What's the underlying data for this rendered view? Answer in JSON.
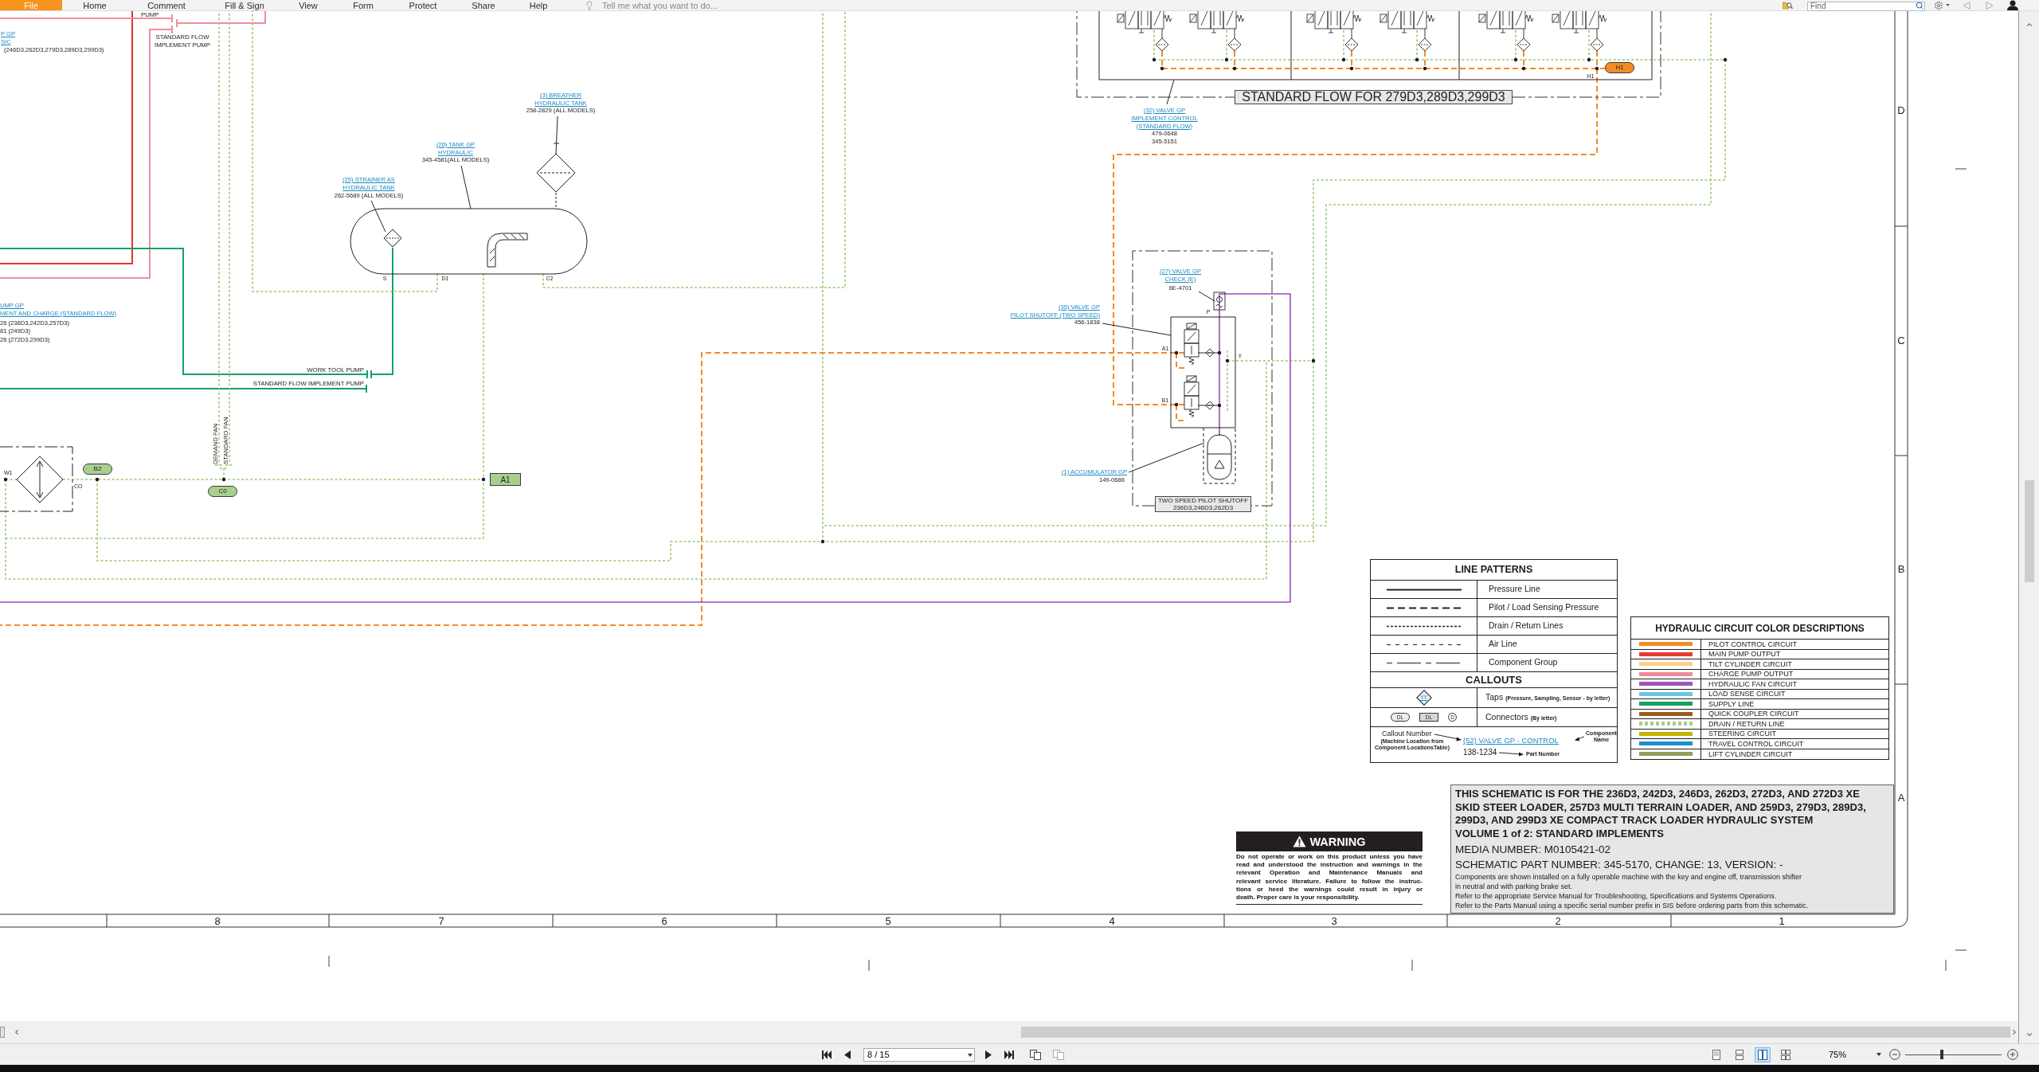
{
  "menu_bar": {
    "items": [
      {
        "label": "File",
        "kind": "file"
      },
      {
        "label": "Home",
        "kind": "tab"
      },
      {
        "label": "Comment",
        "kind": "tab"
      },
      {
        "label": "Fill & Sign",
        "kind": "tab"
      },
      {
        "label": "View",
        "kind": "tab"
      },
      {
        "label": "Form",
        "kind": "tab"
      },
      {
        "label": "Protect",
        "kind": "tab"
      },
      {
        "label": "Share",
        "kind": "tab"
      },
      {
        "label": "Help",
        "kind": "tab"
      }
    ],
    "tell_me": {
      "placeholder": "Tell me what you want to do..."
    },
    "find": {
      "placeholder": "Find"
    }
  },
  "schematic": {
    "line_labels": [
      {
        "lines": [
          "PUMP"
        ]
      },
      {
        "lines": [
          "STANDARD FLOW",
          "IMPLEMENT PUMP"
        ]
      },
      {
        "lines": [
          "WORK TOOL PUMP"
        ]
      },
      {
        "lines": [
          "STANDARD FLOW IMPLEMENT PUMP"
        ]
      },
      {
        "lines": [
          "DEMAND FAN"
        ]
      },
      {
        "lines": [
          "STANDARD FAN"
        ]
      }
    ],
    "callouts": [
      {
        "name": [
          "P GP",
          "SIC"
        ],
        "parts": [
          "(246D3,262D3,279D3,289D3,299D3)"
        ]
      },
      {
        "name": [
          "UMP GP",
          "MENT AND CHARGE (STANDARD FLOW)"
        ],
        "parts": [
          "26 (236D3,242D3,257D3)",
          "81 (249D3)",
          "26 (272D3,299D3)"
        ]
      },
      {
        "name": [
          "(25) STRAINER AS",
          "HYDRAULIC TANK"
        ],
        "parts": [
          "262-5689 (ALL MODELS)"
        ]
      },
      {
        "name": [
          "(26) TANK GP",
          "HYDRAULIC"
        ],
        "parts": [
          "345-4581(ALL MODELS)"
        ]
      },
      {
        "name": [
          "(3) BREATHER",
          "HYDRAULIC TANK"
        ],
        "parts": [
          "258-2829 (ALL MODELS)"
        ]
      },
      {
        "name": [
          "(32) VALVE GP",
          "IMPLEMENT CONTROL",
          "(STANDARD FLOW)"
        ],
        "parts": [
          "479-0648",
          "345-5151"
        ]
      },
      {
        "name": [
          "(27) VALVE GP",
          "CHECK (E)"
        ],
        "parts": [
          "6E-4701"
        ]
      },
      {
        "name": [
          "(35) VALVE GP",
          "PILOT SHUTOFF (TWO SPEED)"
        ],
        "parts": [
          "456-1838"
        ]
      },
      {
        "name": [
          "(1) ACCUMULATOR GP"
        ],
        "parts": [
          "149-0686"
        ]
      }
    ],
    "port_labels": [
      "S",
      "D1",
      "C2",
      "W1",
      "CO",
      "H1",
      "P",
      "A1",
      "B1",
      "T"
    ],
    "connectors": [
      {
        "label": "B2",
        "kind": "pill",
        "color": "#a9cf8f"
      },
      {
        "label": "C0",
        "kind": "pill",
        "color": "#a9cf8f"
      },
      {
        "label": "A1",
        "kind": "tag",
        "color": "#a9cf8f"
      },
      {
        "label": "H1",
        "kind": "pill",
        "color": "#f28c28"
      }
    ],
    "group_labels": [
      {
        "lines": [
          "STANDARD FLOW FOR 279D3,289D3,299D3"
        ]
      },
      {
        "lines": [
          "TWO SPEED PILOT SHUTOFF",
          "236D3,246D3,262D3"
        ]
      }
    ]
  },
  "frame": {
    "rows": [
      "D",
      "C",
      "B",
      "A"
    ],
    "columns": [
      "8",
      "7",
      "6",
      "5",
      "4",
      "3",
      "2",
      "1"
    ]
  },
  "line_patterns": {
    "title": "LINE PATTERNS",
    "rows": [
      {
        "kind": "solid",
        "label": "Pressure Line"
      },
      {
        "kind": "long_dash",
        "label": "Pilot / Load Sensing Pressure"
      },
      {
        "kind": "short_dash",
        "label": "Drain / Return Lines"
      },
      {
        "kind": "sparse_dash",
        "label": "Air Line"
      },
      {
        "kind": "dash_dot",
        "label": "Component Group"
      }
    ],
    "callouts_title": "CALLOUTS",
    "taps": {
      "symbol": "YY",
      "label": "Taps",
      "note": "(Pressure, Sampling, Sensor - by letter)"
    },
    "connectors": {
      "symbols": [
        {
          "kind": "pill",
          "label": "DL"
        },
        {
          "kind": "tag",
          "label": "DL"
        },
        {
          "kind": "circle",
          "label": "D"
        }
      ],
      "label": "Connectors",
      "note": "(By letter)"
    },
    "example": {
      "callout_number": "Callout Number",
      "callout_note": "(Machine Location from Component LocationsTable)",
      "component": "(52) VALVE GP - CONTROL",
      "component_note": "Component Name",
      "part": "138-1234",
      "part_note": "Part Number"
    }
  },
  "color_legend": {
    "title": "HYDRAULIC CIRCUIT COLOR DESCRIPTIONS",
    "rows": [
      {
        "label": "PILOT CONTROL CIRCUIT",
        "color": "#f28c28",
        "kind": "solid"
      },
      {
        "label": "MAIN PUMP OUTPUT",
        "color": "#e53b35",
        "kind": "solid"
      },
      {
        "label": "TILT CYLINDER CIRCUIT",
        "color": "#fcd08f",
        "kind": "solid"
      },
      {
        "label": "CHARGE PUMP OUTPUT",
        "color": "#f18a9e",
        "kind": "solid"
      },
      {
        "label": "HYDRAULIC FAN CIRCUIT",
        "color": "#9b55b5",
        "kind": "solid"
      },
      {
        "label": "LOAD SENSE CIRCUIT",
        "color": "#6cc4e6",
        "kind": "solid"
      },
      {
        "label": "SUPPLY LINE",
        "color": "#13a15f",
        "kind": "solid"
      },
      {
        "label": "QUICK COUPLER CIRCUIT",
        "color": "#9b5c1c",
        "kind": "solid"
      },
      {
        "label": "DRAIN / RETURN LINE",
        "color": "#a7cc8c",
        "kind": "dotted"
      },
      {
        "label": "STEERING CIRCUIT",
        "color": "#c6b300",
        "kind": "solid"
      },
      {
        "label": "TRAVEL CONTROL CIRCUIT",
        "color": "#1b8fcf",
        "kind": "solid"
      },
      {
        "label": "LIFT CYLINDER CIRCUIT",
        "color": "#8e9f58",
        "kind": "solid"
      }
    ]
  },
  "warning": {
    "title": "WARNING",
    "lines": [
      "Do not operate or work on this product unless you have",
      "read and understood the instruction and warnings in the",
      "relevant Operation and Maintenance Manuals and",
      "relevant service literature. Failure to follow the instruc-",
      "tions or heed the warnings could result in injury or",
      "death. Proper care is your responsibility."
    ]
  },
  "title_block": {
    "heading_lines": [
      "THIS SCHEMATIC IS FOR THE 236D3, 242D3, 246D3, 262D3, 272D3, AND 272D3 XE",
      "SKID STEER LOADER, 257D3 MULTI TERRAIN LOADER, AND 259D3, 279D3, 289D3,",
      "299D3, AND 299D3 XE COMPACT TRACK LOADER HYDRAULIC SYSTEM"
    ],
    "volume": "VOLUME 1 of 2: STANDARD IMPLEMENTS",
    "media_number": "MEDIA NUMBER: M0105421-02",
    "part_number": "SCHEMATIC PART NUMBER: 345-5170, CHANGE: 13, VERSION: -",
    "notes": [
      {
        "lines": [
          "Components are shown installed on a fully operable machine with the key and engine off, transmission shifter",
          "in neutral and with parking brake set."
        ]
      },
      {
        "lines": [
          "Refer to the appropriate Service Manual for Troubleshooting, Specifications and Systems Operations."
        ]
      },
      {
        "lines": [
          "Refer to the Parts Manual using a specific serial number prefix in SIS before ordering parts from this schematic."
        ]
      }
    ]
  },
  "status_bar": {
    "page": "8 / 15",
    "view_buttons": [
      {
        "selected": false
      },
      {
        "selected": false
      },
      {
        "selected": true
      },
      {
        "selected": false
      }
    ],
    "zoom": "75%",
    "zoom_slider": {
      "level": 0.38
    }
  }
}
